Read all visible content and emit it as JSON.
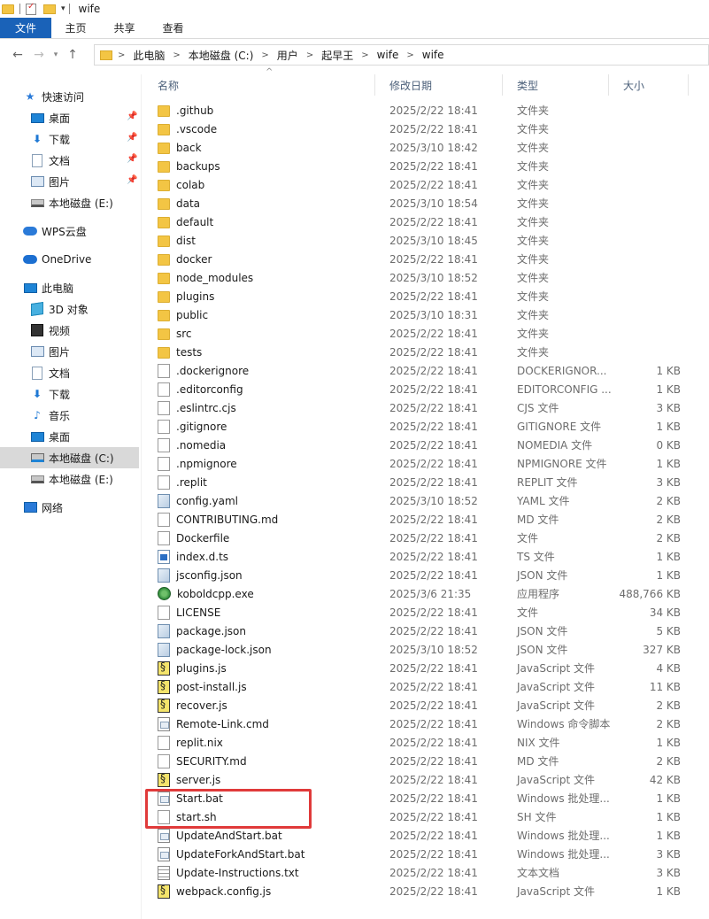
{
  "window": {
    "title": "wife"
  },
  "ribbon": {
    "tabs": [
      "文件",
      "主页",
      "共享",
      "查看"
    ]
  },
  "nav": {
    "back": "←",
    "forward": "→",
    "dropdown": "▾",
    "up": "↑",
    "breadcrumbs": [
      "此电脑",
      "本地磁盘 (C:)",
      "用户",
      "起早王",
      "wife",
      "wife"
    ]
  },
  "sidebar": {
    "items": [
      {
        "label": "快速访问",
        "icon": "star-icon",
        "pinned": false
      },
      {
        "label": "桌面",
        "icon": "desktop-icon",
        "pinned": true
      },
      {
        "label": "下载",
        "icon": "download-icon",
        "pinned": true
      },
      {
        "label": "文档",
        "icon": "document-icon",
        "pinned": true
      },
      {
        "label": "图片",
        "icon": "pictures-icon",
        "pinned": true
      },
      {
        "label": "本地磁盘 (E:)",
        "icon": "drive-icon",
        "pinned": false
      },
      {
        "label": "WPS云盘",
        "icon": "cloud-icon",
        "pinned": false
      },
      {
        "label": "OneDrive",
        "icon": "onedrive-icon",
        "pinned": false
      },
      {
        "label": "此电脑",
        "icon": "computer-icon",
        "pinned": false
      },
      {
        "label": "3D 对象",
        "icon": "3d-objects-icon",
        "pinned": false
      },
      {
        "label": "视频",
        "icon": "video-icon",
        "pinned": false
      },
      {
        "label": "图片",
        "icon": "pictures-icon",
        "pinned": false
      },
      {
        "label": "文档",
        "icon": "document-icon",
        "pinned": false
      },
      {
        "label": "下载",
        "icon": "download-icon",
        "pinned": false
      },
      {
        "label": "音乐",
        "icon": "music-icon",
        "pinned": false
      },
      {
        "label": "桌面",
        "icon": "desktop-icon",
        "pinned": false
      },
      {
        "label": "本地磁盘 (C:)",
        "icon": "system-drive-icon",
        "pinned": false,
        "selected": true
      },
      {
        "label": "本地磁盘 (E:)",
        "icon": "drive-icon",
        "pinned": false
      },
      {
        "label": "网络",
        "icon": "network-icon",
        "pinned": false
      }
    ]
  },
  "columns": {
    "name": "名称",
    "date": "修改日期",
    "type": "类型",
    "size": "大小"
  },
  "files": [
    {
      "name": ".github",
      "date": "2025/2/22 18:41",
      "type": "文件夹",
      "size": "",
      "icon": "folder"
    },
    {
      "name": ".vscode",
      "date": "2025/2/22 18:41",
      "type": "文件夹",
      "size": "",
      "icon": "folder"
    },
    {
      "name": "back",
      "date": "2025/3/10 18:42",
      "type": "文件夹",
      "size": "",
      "icon": "folder"
    },
    {
      "name": "backups",
      "date": "2025/2/22 18:41",
      "type": "文件夹",
      "size": "",
      "icon": "folder"
    },
    {
      "name": "colab",
      "date": "2025/2/22 18:41",
      "type": "文件夹",
      "size": "",
      "icon": "folder"
    },
    {
      "name": "data",
      "date": "2025/3/10 18:54",
      "type": "文件夹",
      "size": "",
      "icon": "folder"
    },
    {
      "name": "default",
      "date": "2025/2/22 18:41",
      "type": "文件夹",
      "size": "",
      "icon": "folder"
    },
    {
      "name": "dist",
      "date": "2025/3/10 18:45",
      "type": "文件夹",
      "size": "",
      "icon": "folder"
    },
    {
      "name": "docker",
      "date": "2025/2/22 18:41",
      "type": "文件夹",
      "size": "",
      "icon": "folder"
    },
    {
      "name": "node_modules",
      "date": "2025/3/10 18:52",
      "type": "文件夹",
      "size": "",
      "icon": "folder"
    },
    {
      "name": "plugins",
      "date": "2025/2/22 18:41",
      "type": "文件夹",
      "size": "",
      "icon": "folder"
    },
    {
      "name": "public",
      "date": "2025/3/10 18:31",
      "type": "文件夹",
      "size": "",
      "icon": "folder"
    },
    {
      "name": "src",
      "date": "2025/2/22 18:41",
      "type": "文件夹",
      "size": "",
      "icon": "folder"
    },
    {
      "name": "tests",
      "date": "2025/2/22 18:41",
      "type": "文件夹",
      "size": "",
      "icon": "folder"
    },
    {
      "name": ".dockerignore",
      "date": "2025/2/22 18:41",
      "type": "DOCKERIGNOR...",
      "size": "1 KB",
      "icon": "file"
    },
    {
      "name": ".editorconfig",
      "date": "2025/2/22 18:41",
      "type": "EDITORCONFIG ...",
      "size": "1 KB",
      "icon": "file"
    },
    {
      "name": ".eslintrc.cjs",
      "date": "2025/2/22 18:41",
      "type": "CJS 文件",
      "size": "3 KB",
      "icon": "file"
    },
    {
      "name": ".gitignore",
      "date": "2025/2/22 18:41",
      "type": "GITIGNORE 文件",
      "size": "1 KB",
      "icon": "file"
    },
    {
      "name": ".nomedia",
      "date": "2025/2/22 18:41",
      "type": "NOMEDIA 文件",
      "size": "0 KB",
      "icon": "file"
    },
    {
      "name": ".npmignore",
      "date": "2025/2/22 18:41",
      "type": "NPMIGNORE 文件",
      "size": "1 KB",
      "icon": "file"
    },
    {
      "name": ".replit",
      "date": "2025/2/22 18:41",
      "type": "REPLIT 文件",
      "size": "3 KB",
      "icon": "file"
    },
    {
      "name": "config.yaml",
      "date": "2025/3/10 18:52",
      "type": "YAML 文件",
      "size": "2 KB",
      "icon": "yaml"
    },
    {
      "name": "CONTRIBUTING.md",
      "date": "2025/2/22 18:41",
      "type": "MD 文件",
      "size": "2 KB",
      "icon": "file"
    },
    {
      "name": "Dockerfile",
      "date": "2025/2/22 18:41",
      "type": "文件",
      "size": "2 KB",
      "icon": "file"
    },
    {
      "name": "index.d.ts",
      "date": "2025/2/22 18:41",
      "type": "TS 文件",
      "size": "1 KB",
      "icon": "ts"
    },
    {
      "name": "jsconfig.json",
      "date": "2025/2/22 18:41",
      "type": "JSON 文件",
      "size": "1 KB",
      "icon": "yaml"
    },
    {
      "name": "koboldcpp.exe",
      "date": "2025/3/6 21:35",
      "type": "应用程序",
      "size": "488,766 KB",
      "icon": "exe"
    },
    {
      "name": "LICENSE",
      "date": "2025/2/22 18:41",
      "type": "文件",
      "size": "34 KB",
      "icon": "file"
    },
    {
      "name": "package.json",
      "date": "2025/2/22 18:41",
      "type": "JSON 文件",
      "size": "5 KB",
      "icon": "yaml"
    },
    {
      "name": "package-lock.json",
      "date": "2025/3/10 18:52",
      "type": "JSON 文件",
      "size": "327 KB",
      "icon": "yaml"
    },
    {
      "name": "plugins.js",
      "date": "2025/2/22 18:41",
      "type": "JavaScript 文件",
      "size": "4 KB",
      "icon": "js"
    },
    {
      "name": "post-install.js",
      "date": "2025/2/22 18:41",
      "type": "JavaScript 文件",
      "size": "11 KB",
      "icon": "js"
    },
    {
      "name": "recover.js",
      "date": "2025/2/22 18:41",
      "type": "JavaScript 文件",
      "size": "2 KB",
      "icon": "js"
    },
    {
      "name": "Remote-Link.cmd",
      "date": "2025/2/22 18:41",
      "type": "Windows 命令脚本",
      "size": "2 KB",
      "icon": "cmd"
    },
    {
      "name": "replit.nix",
      "date": "2025/2/22 18:41",
      "type": "NIX 文件",
      "size": "1 KB",
      "icon": "file"
    },
    {
      "name": "SECURITY.md",
      "date": "2025/2/22 18:41",
      "type": "MD 文件",
      "size": "2 KB",
      "icon": "file"
    },
    {
      "name": "server.js",
      "date": "2025/2/22 18:41",
      "type": "JavaScript 文件",
      "size": "42 KB",
      "icon": "js"
    },
    {
      "name": "Start.bat",
      "date": "2025/2/22 18:41",
      "type": "Windows 批处理...",
      "size": "1 KB",
      "icon": "cmd"
    },
    {
      "name": "start.sh",
      "date": "2025/2/22 18:41",
      "type": "SH 文件",
      "size": "1 KB",
      "icon": "file"
    },
    {
      "name": "UpdateAndStart.bat",
      "date": "2025/2/22 18:41",
      "type": "Windows 批处理...",
      "size": "1 KB",
      "icon": "cmd"
    },
    {
      "name": "UpdateForkAndStart.bat",
      "date": "2025/2/22 18:41",
      "type": "Windows 批处理...",
      "size": "3 KB",
      "icon": "cmd"
    },
    {
      "name": "Update-Instructions.txt",
      "date": "2025/2/22 18:41",
      "type": "文本文档",
      "size": "3 KB",
      "icon": "txt"
    },
    {
      "name": "webpack.config.js",
      "date": "2025/2/22 18:41",
      "type": "JavaScript 文件",
      "size": "1 KB",
      "icon": "js"
    }
  ],
  "annotation": {
    "color": "#e03a3a"
  }
}
